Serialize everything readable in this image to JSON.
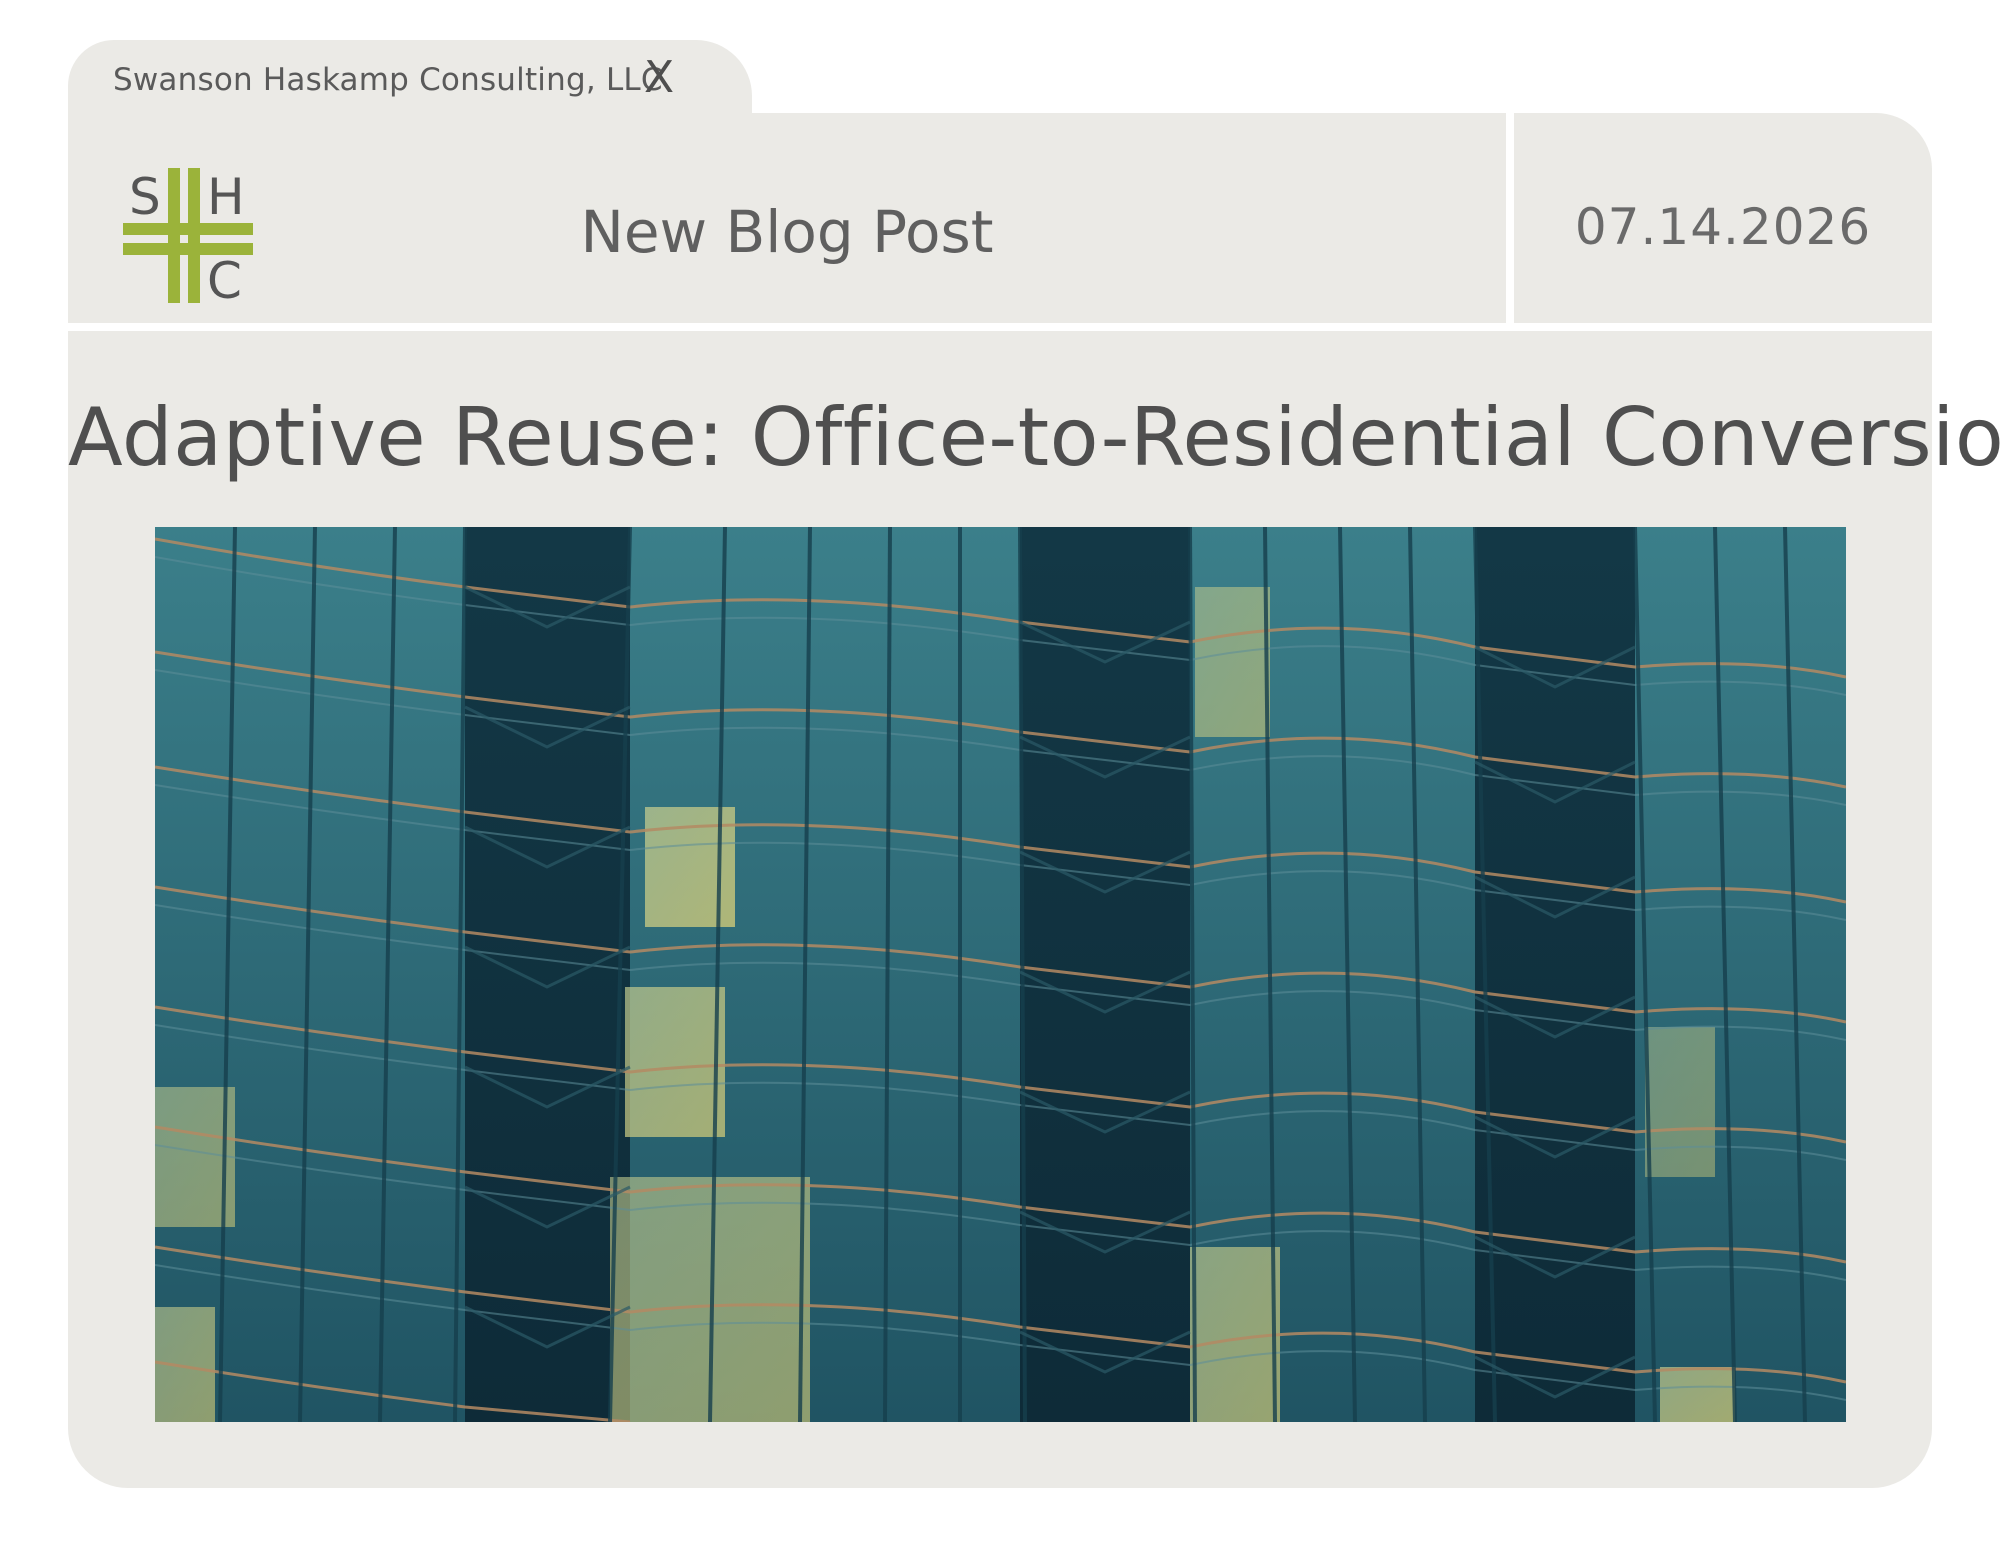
{
  "tab": {
    "title": "Swanson Haskamp Consulting, LLC",
    "close_label": "X"
  },
  "header": {
    "title": "New Blog Post",
    "date": "07.14.2026"
  },
  "logo": {
    "letters": [
      "S",
      "H",
      "C"
    ],
    "accent_color": "#9bb33a",
    "text_color": "#555555"
  },
  "post": {
    "title": "Adaptive Reuse: Office-to-Residential Conversions"
  },
  "colors": {
    "panel": "#ebeae6",
    "background": "#ffffff",
    "text": "#5f5f5f"
  }
}
